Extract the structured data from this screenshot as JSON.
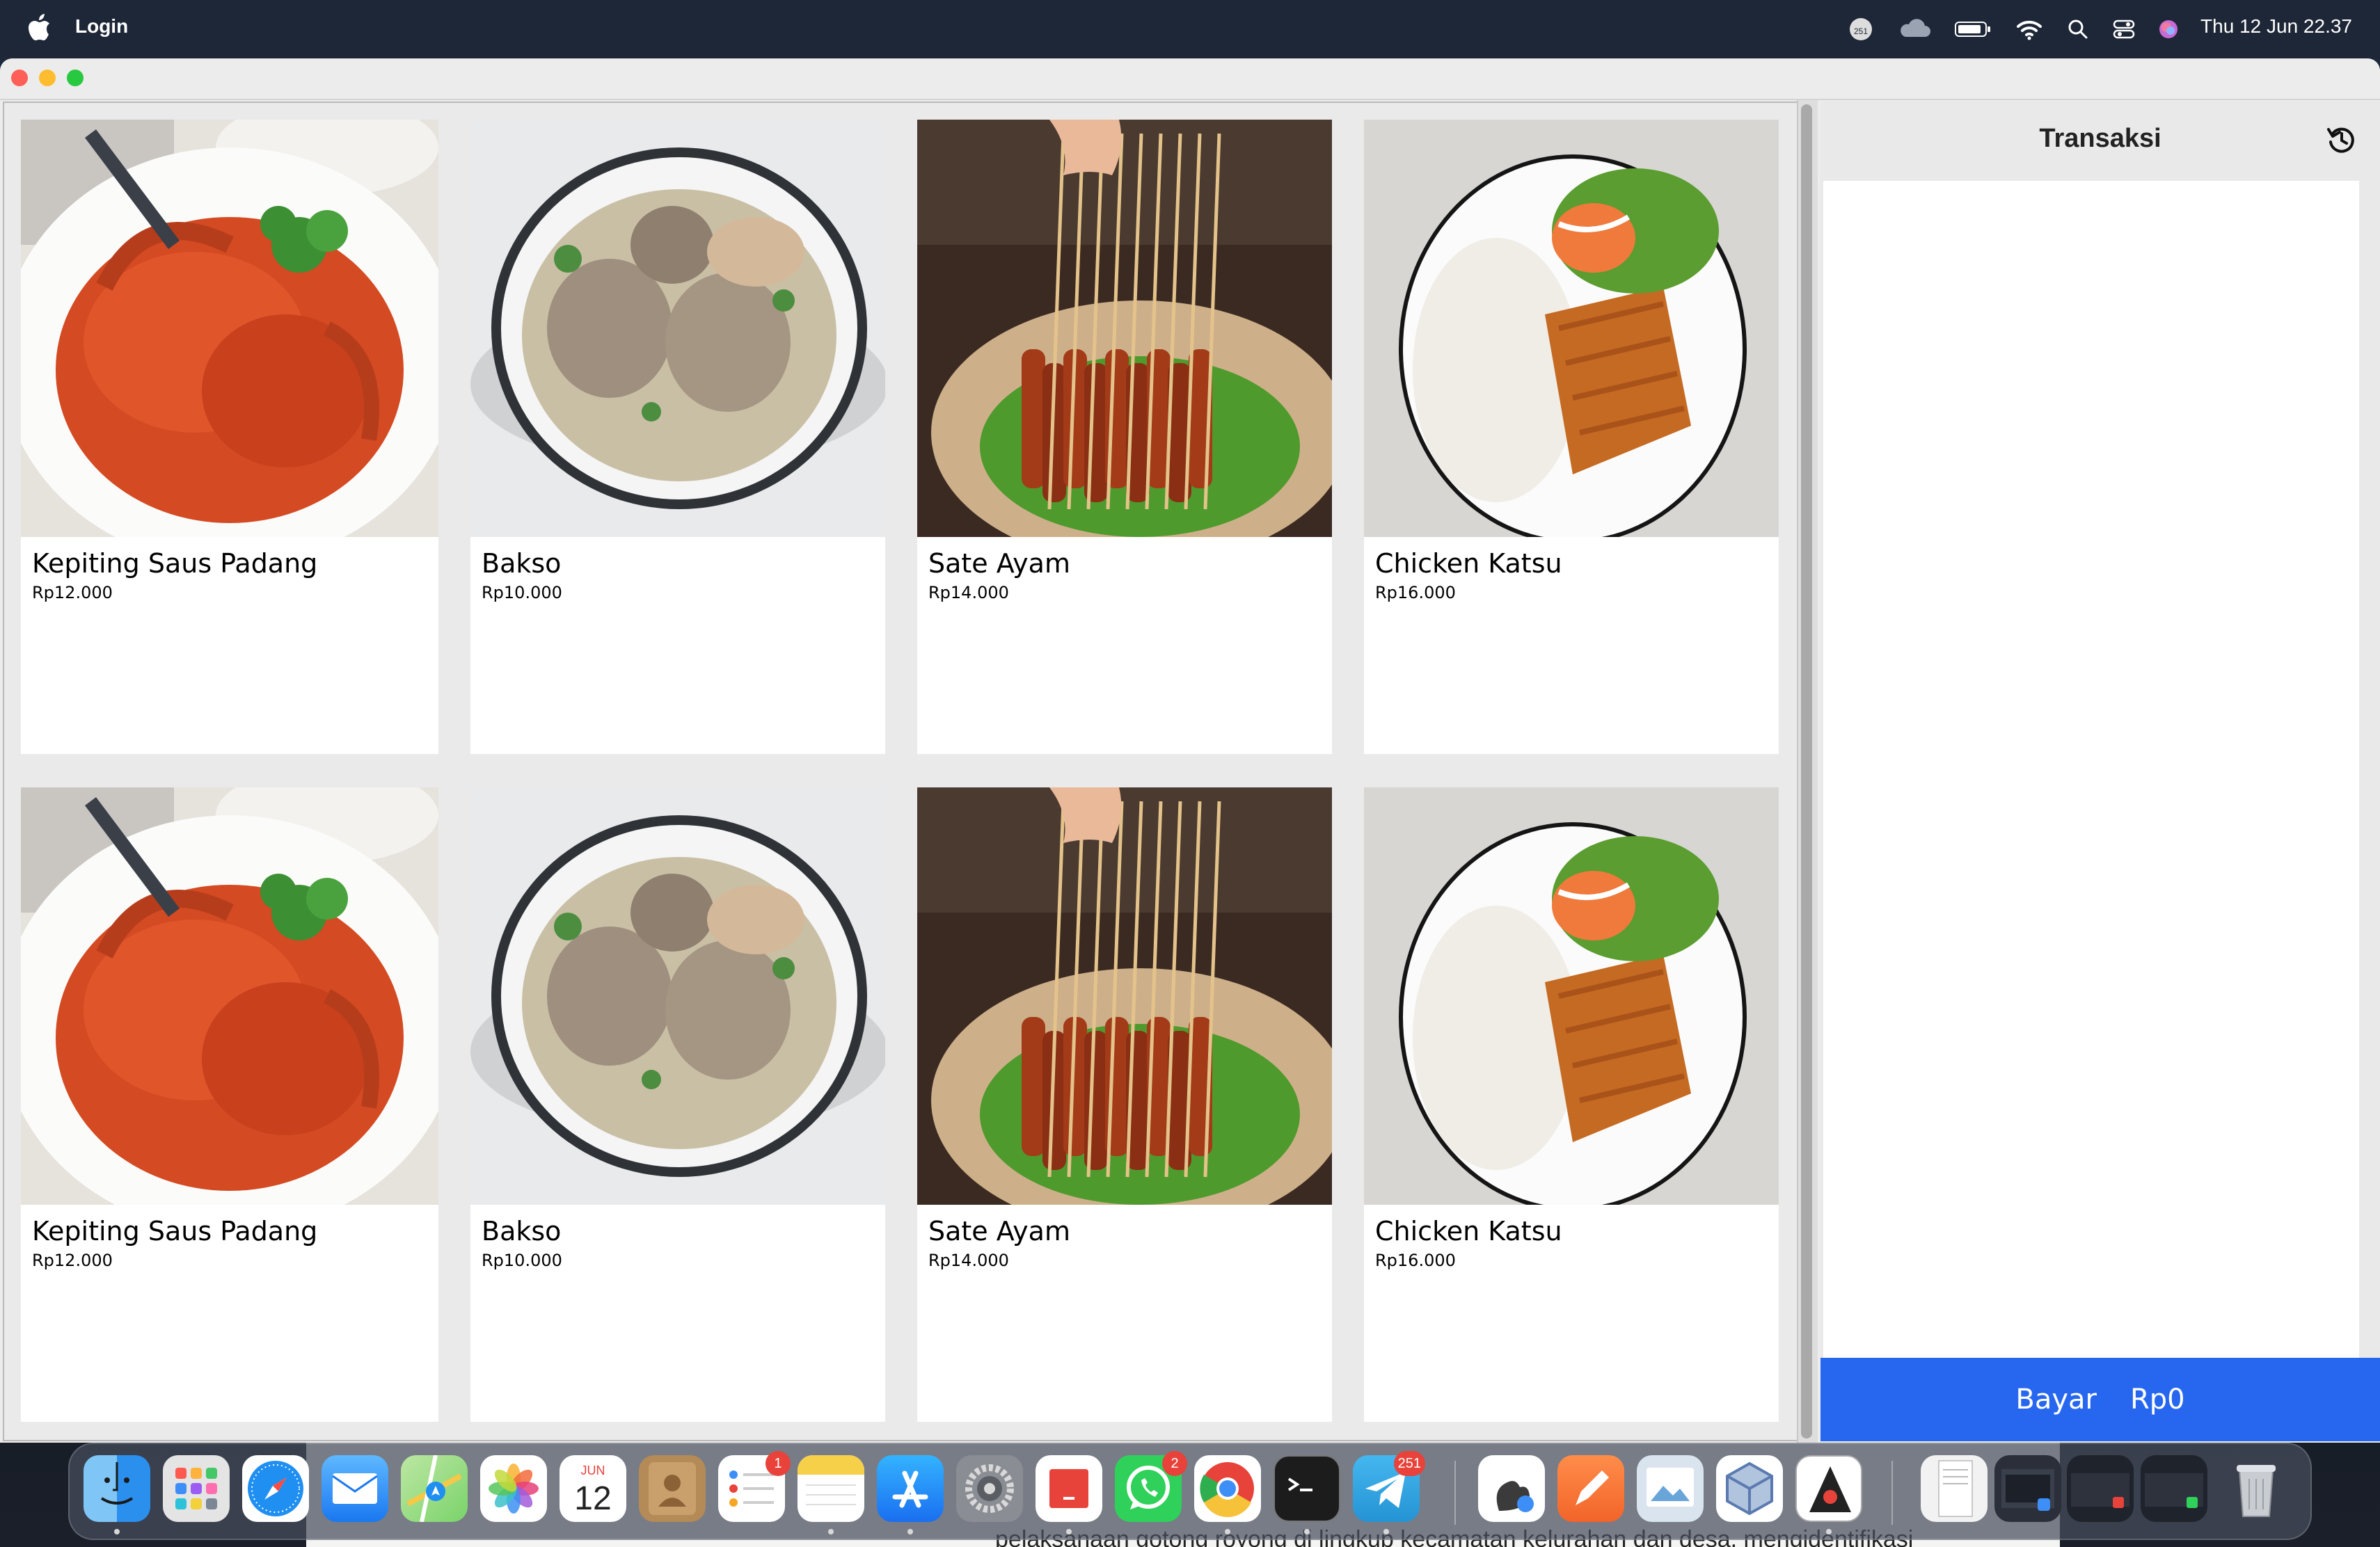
{
  "menubar": {
    "app_name": "Login",
    "notification_count": "251",
    "clock": "Thu 12 Jun  22.37"
  },
  "menu": {
    "items": [
      {
        "name": "Kepiting Saus Padang",
        "price": "Rp12.000",
        "image": "crab"
      },
      {
        "name": "Bakso",
        "price": "Rp10.000",
        "image": "meatball-soup"
      },
      {
        "name": "Sate Ayam",
        "price": "Rp14.000",
        "image": "satay"
      },
      {
        "name": "Chicken Katsu",
        "price": "Rp16.000",
        "image": "katsu"
      },
      {
        "name": "Kepiting Saus Padang",
        "price": "Rp12.000",
        "image": "crab"
      },
      {
        "name": "Bakso",
        "price": "Rp10.000",
        "image": "meatball-soup"
      },
      {
        "name": "Sate Ayam",
        "price": "Rp14.000",
        "image": "satay"
      },
      {
        "name": "Chicken Katsu",
        "price": "Rp16.000",
        "image": "katsu"
      }
    ]
  },
  "transaction": {
    "title": "Transaksi",
    "pay_label": "Bayar",
    "total": "Rp0"
  },
  "dock": {
    "calendar_month": "JUN",
    "calendar_day": "12",
    "badges": {
      "reminders": "1",
      "whatsapp": "2",
      "telegram": "251"
    }
  },
  "desktop": {
    "doc_text": "pelaksanaan gotong royong di lingkup kecamatan kelurahan dan desa. mengidentifikasi"
  },
  "colors": {
    "pay_button": "#2767f0",
    "menubar": "#1e2737"
  }
}
